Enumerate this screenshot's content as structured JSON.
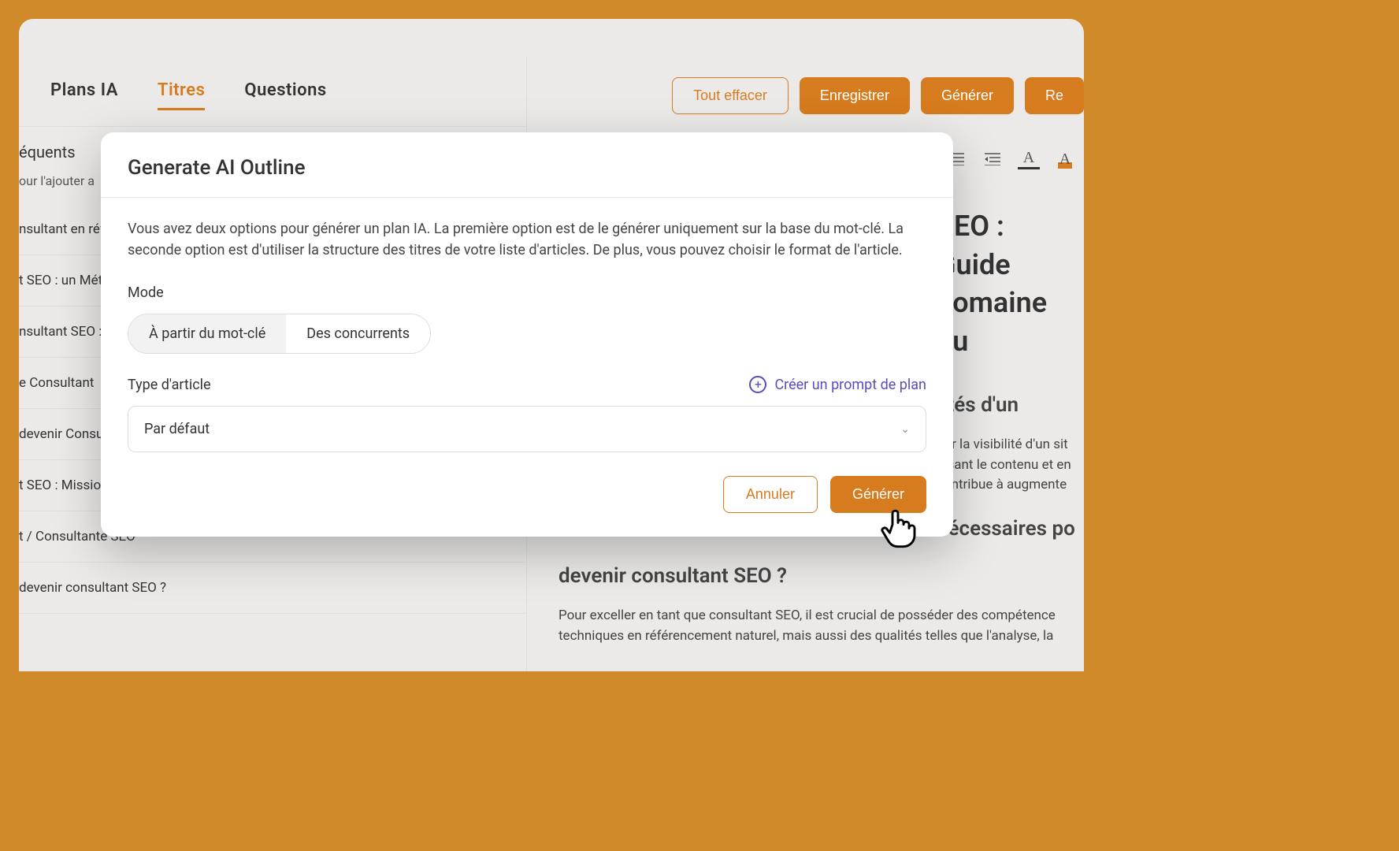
{
  "tabs": {
    "plans": "Plans IA",
    "titres": "Titres",
    "questions": "Questions"
  },
  "left": {
    "heading_suffix": "équents",
    "sub_suffix": "our l'ajouter a",
    "items": [
      "nsultant en réf",
      "t SEO : un Mét",
      "nsultant SEO :",
      "e Consultant",
      "devenir Consu",
      "t SEO : Missior",
      "t / Consultante SEO",
      "devenir consultant SEO ?"
    ]
  },
  "toolbar": {
    "clear": "Tout effacer",
    "save": "Enregistrer",
    "generate": "Générer",
    "re": "Re"
  },
  "editor_tools": {
    "outdent": "⇤",
    "indent": "⇥",
    "textcolor": "A",
    "highlight": "A"
  },
  "article": {
    "h1_line1": "SEO : Guide",
    "h1_line2": "domaine du",
    "h2a_line1": "lités d'un",
    "p1": "ntir la visibilité d'un sit  nisant le contenu et en  contribue à augmente",
    "h2b_line1": "nécessaires po",
    "h2b_line2": "devenir consultant SEO ?",
    "p2": "Pour exceller en tant que consultant SEO, il est crucial de posséder des compétence techniques en référencement naturel, mais aussi des qualités telles que l'analyse, la"
  },
  "modal": {
    "title": "Generate AI Outline",
    "description": "Vous avez deux options pour générer un plan IA. La première option est de le générer uniquement sur la base du mot-clé. La seconde option est d'utiliser la structure des titres de votre liste d'articles. De plus, vous pouvez choisir le format de l'article.",
    "mode_label": "Mode",
    "mode_options": {
      "keyword": "À partir du mot-clé",
      "competitors": "Des concurrents"
    },
    "type_label": "Type d'article",
    "create_prompt": "Créer un prompt de plan",
    "select_value": "Par défaut",
    "cancel": "Annuler",
    "generate": "Générer"
  }
}
